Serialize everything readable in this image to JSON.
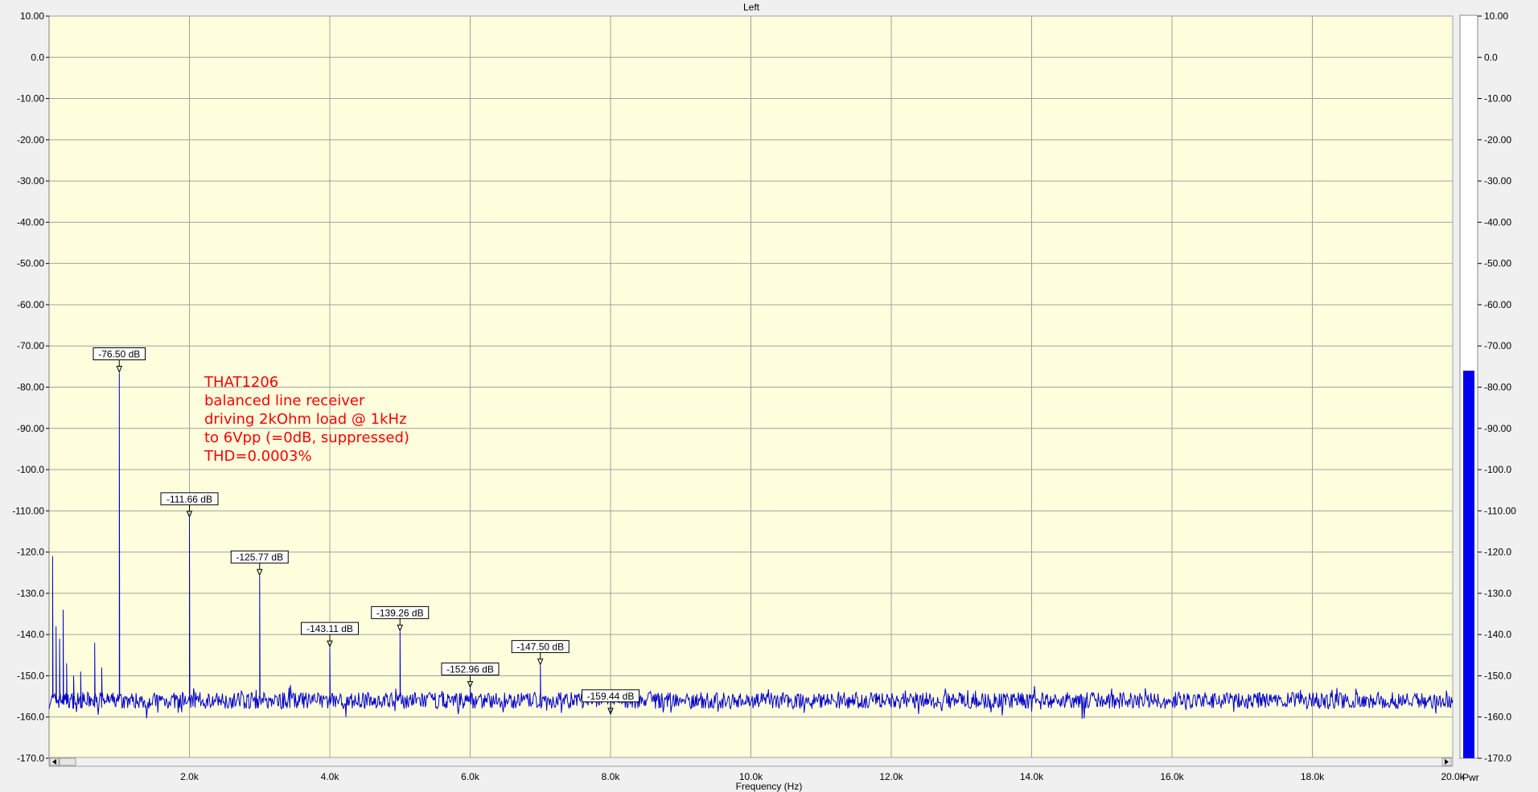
{
  "chart_data": {
    "type": "line",
    "title": "Left",
    "xlabel": "Frequency (Hz)",
    "ylabel": "",
    "xlim": [
      0,
      20000
    ],
    "ylim": [
      -170,
      10
    ],
    "x_ticks": [
      {
        "value": 2000,
        "label": "2.0k"
      },
      {
        "value": 4000,
        "label": "4.0k"
      },
      {
        "value": 6000,
        "label": "6.0k"
      },
      {
        "value": 8000,
        "label": "8.0k"
      },
      {
        "value": 10000,
        "label": "10.0k"
      },
      {
        "value": 12000,
        "label": "12.0k"
      },
      {
        "value": 14000,
        "label": "14.0k"
      },
      {
        "value": 16000,
        "label": "16.0k"
      },
      {
        "value": 18000,
        "label": "18.0k"
      },
      {
        "value": 20000,
        "label": "20.0k"
      }
    ],
    "y_ticks": [
      {
        "value": 10,
        "label": "10.00"
      },
      {
        "value": 0,
        "label": "0.0"
      },
      {
        "value": -10,
        "label": "-10.00"
      },
      {
        "value": -20,
        "label": "-20.00"
      },
      {
        "value": -30,
        "label": "-30.00"
      },
      {
        "value": -40,
        "label": "-40.00"
      },
      {
        "value": -50,
        "label": "-50.00"
      },
      {
        "value": -60,
        "label": "-60.00"
      },
      {
        "value": -70,
        "label": "-70.00"
      },
      {
        "value": -80,
        "label": "-80.00"
      },
      {
        "value": -90,
        "label": "-90.00"
      },
      {
        "value": -100,
        "label": "-100.0"
      },
      {
        "value": -110,
        "label": "-110.00"
      },
      {
        "value": -120,
        "label": "-120.0"
      },
      {
        "value": -130,
        "label": "-130.0"
      },
      {
        "value": -140,
        "label": "-140.0"
      },
      {
        "value": -150,
        "label": "-150.0"
      },
      {
        "value": -160,
        "label": "-160.0"
      },
      {
        "value": -170,
        "label": "-170.0"
      }
    ],
    "noise_floor_db": -156,
    "peaks": [
      {
        "x": 1000,
        "y": -76.5,
        "label": "-76.50 dB"
      },
      {
        "x": 2000,
        "y": -111.66,
        "label": "-111.66 dB"
      },
      {
        "x": 3000,
        "y": -125.77,
        "label": "-125.77 dB"
      },
      {
        "x": 4000,
        "y": -143.11,
        "label": "-143.11 dB"
      },
      {
        "x": 5000,
        "y": -139.26,
        "label": "-139.26 dB"
      },
      {
        "x": 6000,
        "y": -152.96,
        "label": "-152.96 dB"
      },
      {
        "x": 7000,
        "y": -147.5,
        "label": "-147.50 dB"
      },
      {
        "x": 8000,
        "y": -159.44,
        "label": "-159.44 dB"
      }
    ],
    "low_freq_spurs": [
      {
        "x": 50,
        "y": -121
      },
      {
        "x": 100,
        "y": -138
      },
      {
        "x": 150,
        "y": -141
      },
      {
        "x": 200,
        "y": -134
      },
      {
        "x": 250,
        "y": -147
      },
      {
        "x": 350,
        "y": -150
      },
      {
        "x": 450,
        "y": -149
      },
      {
        "x": 650,
        "y": -142
      },
      {
        "x": 750,
        "y": -148
      }
    ],
    "annotation": "THAT1206\nbalanced line receiver\ndriving 2kOhm load @ 1kHz\nto 6Vpp (=0dB, suppressed)\nTHD=0.0003%",
    "series_color": "#0000cc",
    "plot_background": "#ffffdd",
    "grid": true,
    "power_meter": {
      "label": "Pwr",
      "level_db": -76,
      "ylim": [
        -170,
        10
      ],
      "tick_labels": [
        "10.00",
        "0.0",
        "-10.00",
        "-20.00",
        "-30.00",
        "-40.00",
        "-50.00",
        "-60.00",
        "-70.00",
        "-80.00",
        "-90.00",
        "-100.0",
        "-110.00",
        "-120.0",
        "-130.0",
        "-140.0",
        "-150.0",
        "-160.0",
        "-170.0"
      ],
      "bar_color": "#0000ee"
    }
  }
}
